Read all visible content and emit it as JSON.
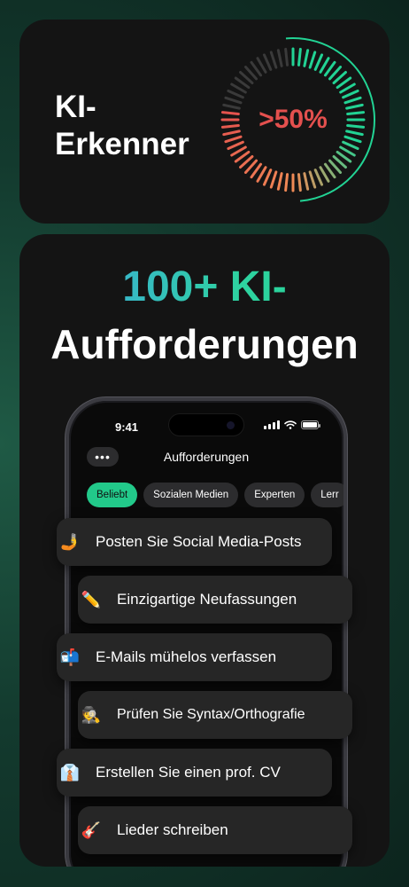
{
  "top_card": {
    "title": "KI-Erkenner",
    "gauge_value": ">50%",
    "gauge_fill": 0.5
  },
  "bottom_card": {
    "headline_1": "100+ KI-",
    "headline_2": "Aufforderungen"
  },
  "phone": {
    "status_time": "9:41",
    "menu_label": "•••",
    "nav_title": "Aufforderungen",
    "chips": [
      "Beliebt",
      "Sozialen Medien",
      "Experten",
      "Lerr"
    ],
    "active_chip": "Beliebt"
  },
  "prompts": [
    {
      "emoji": "🤳",
      "label": "Posten Sie Social Media-Posts"
    },
    {
      "emoji": "✏️",
      "label": "Einzigartige Neufassungen"
    },
    {
      "emoji": "📬",
      "label": "E-Mails mühelos verfassen"
    },
    {
      "emoji": "🕵",
      "label": "Prüfen Sie Syntax/Orthografie"
    },
    {
      "emoji": "👔",
      "label": "Erstellen Sie einen prof. CV"
    },
    {
      "emoji": "🎸",
      "label": "Lieder schreiben"
    }
  ],
  "colors": {
    "accent_green": "#22c98a",
    "gauge_red": "#e4504e",
    "gauge_orange": "#f08a55",
    "gauge_green": "#22d394",
    "card_bg": "#141414"
  }
}
